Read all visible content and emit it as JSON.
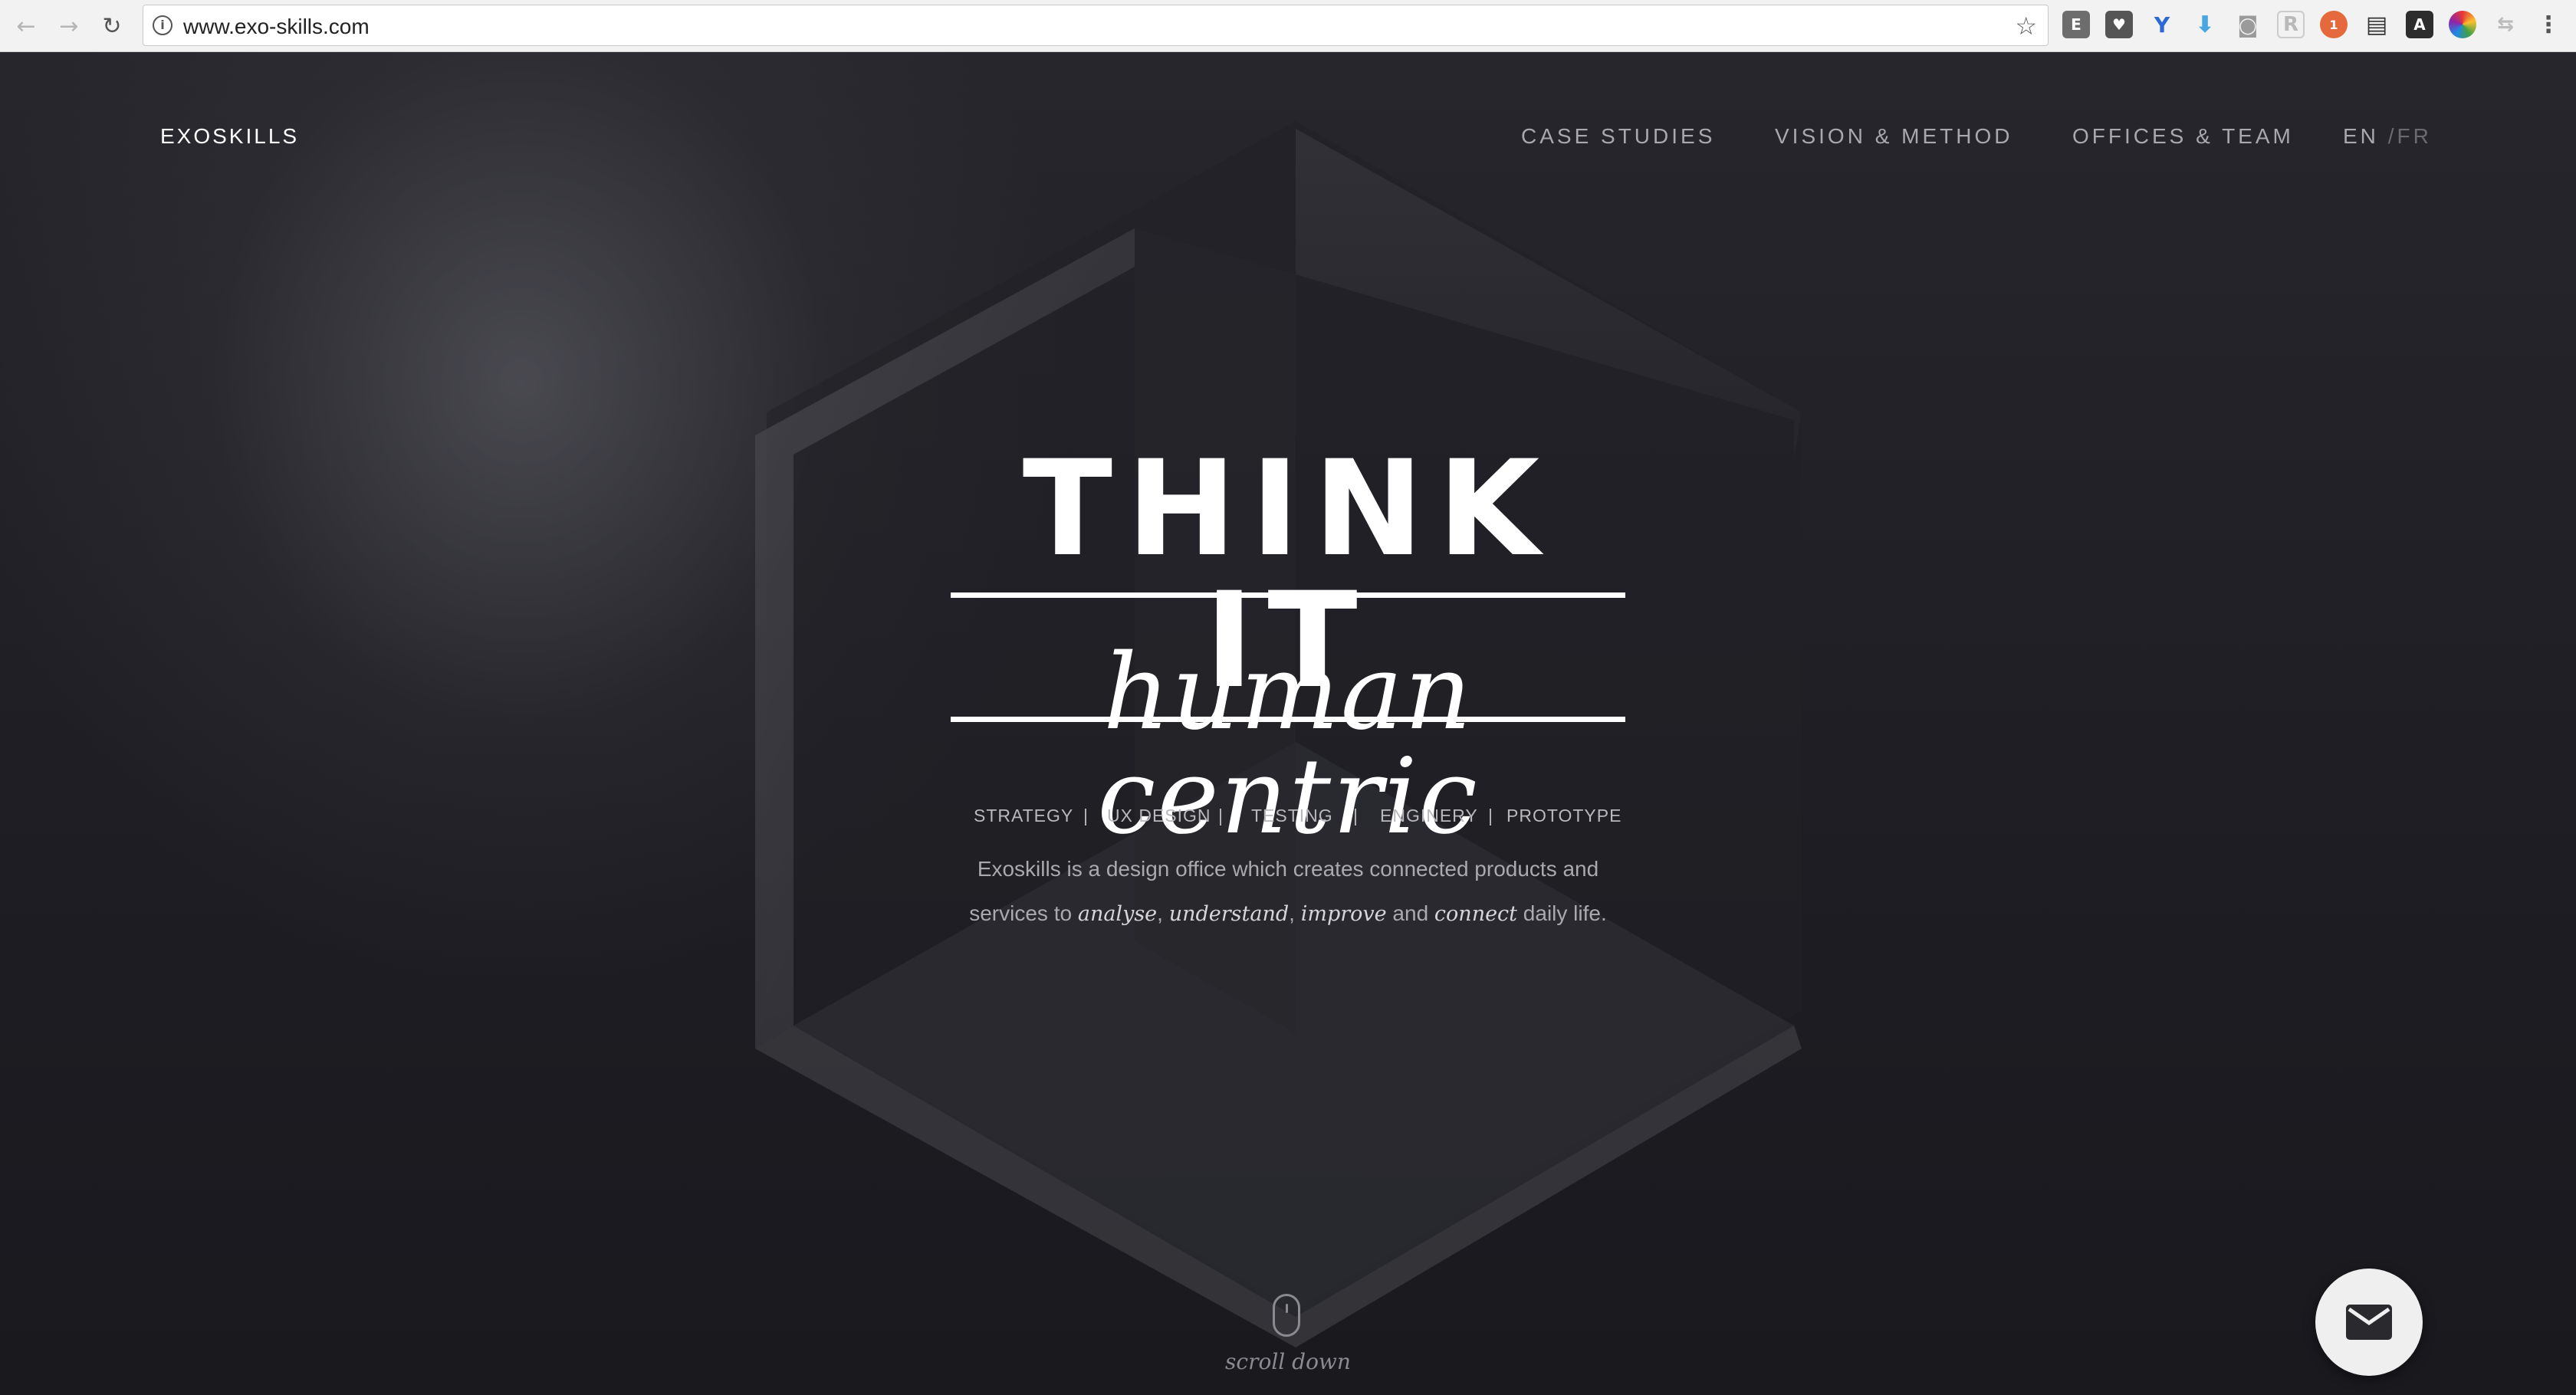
{
  "browser": {
    "url": "www.exo-skills.com",
    "back_icon": "arrow-left-icon",
    "forward_icon": "arrow-right-icon",
    "reload_icon": "reload-icon",
    "extension_badge": "1"
  },
  "header": {
    "brand": "EXOSKILLS",
    "menu": [
      "CASE STUDIES",
      "VISION & METHOD",
      "OFFICES & TEAM"
    ],
    "lang_en": "EN",
    "lang_fr": "/FR"
  },
  "hero": {
    "title": "THINK IT",
    "subtitle": "human centric",
    "services": [
      "STRATEGY",
      "UX DESIGN",
      "TESTING",
      "ENGINERY",
      "PROTOTYPE"
    ],
    "separator": "|",
    "description": {
      "line1": "Exoskills is a design office which creates connected products and",
      "line2_prefix": "services to ",
      "word1": "analyse",
      "comma1": ", ",
      "word2": "understand",
      "comma2": ", ",
      "word3": "improve",
      "and": " and ",
      "word4": "connect",
      "line2_suffix": " daily life."
    },
    "scroll_label": "scroll down"
  },
  "colors": {
    "background": "#1b1b20",
    "text": "#ffffff",
    "muted": "#a8a8ae",
    "fab": "#efefef"
  }
}
